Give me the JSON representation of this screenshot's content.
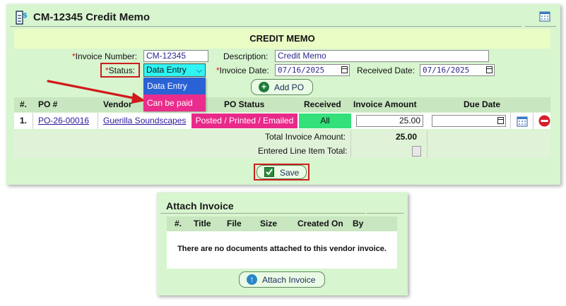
{
  "memo": {
    "title": "CM-12345 Credit Memo",
    "banner": "CREDIT MEMO",
    "invoice_number_label": "Invoice Number:",
    "invoice_number": "CM-12345",
    "description_label": "Description:",
    "description": "Credit Memo",
    "status_label": "Status:",
    "status_value": "Data Entry",
    "status_options": [
      "Data Entry",
      "Can be paid"
    ],
    "invoice_date_label": "Invoice Date:",
    "invoice_date": "07/16/2025",
    "received_date_label": "Received Date:",
    "received_date": "07/16/2025",
    "add_po_label": "Add PO",
    "required_mark": "*"
  },
  "table": {
    "headers": [
      "#.",
      "PO #",
      "Vendor",
      "PO Status",
      "Received",
      "Invoice Amount",
      "Due Date"
    ],
    "rows": [
      {
        "num": "1.",
        "po": "PO-26-00016",
        "vendor": "Guerilla Soundscapes",
        "po_status": "Posted / Printed / Emailed",
        "received": "All",
        "amount": "25.00",
        "due_date": ""
      }
    ],
    "total_invoice_label": "Total Invoice Amount:",
    "total_invoice_value": "25.00",
    "entered_line_label": "Entered Line Item Total:"
  },
  "save_label": "Save",
  "attach": {
    "title": "Attach Invoice",
    "headers": [
      "#.",
      "Title",
      "File",
      "Size",
      "Created On",
      "By"
    ],
    "empty_message": "There are no documents attached to this vendor invoice.",
    "button_label": "Attach Invoice"
  },
  "colors": {
    "panel": "#d7f5cf",
    "status_select": "#2ff4f4",
    "po_status": "#e9298a",
    "received": "#33e07a",
    "highlight": "#cc1d1d",
    "dropdown_selected": "#2a62d6",
    "dropdown_option": "#ea2d8c"
  },
  "icons": [
    "document-dollar-icon",
    "calendar-icon",
    "plus-circle-icon",
    "remove-icon",
    "checkmark-icon",
    "upload-arrow-icon",
    "annotation-arrow"
  ]
}
